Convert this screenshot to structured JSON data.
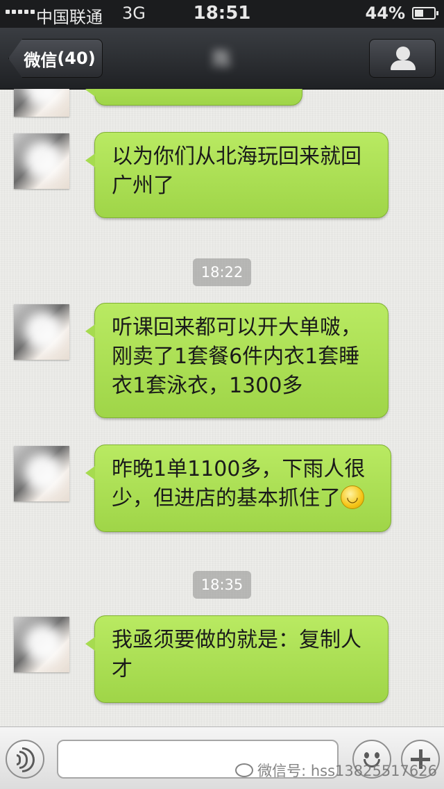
{
  "status_bar": {
    "carrier": "中国联通",
    "network": "3G",
    "time": "18:51",
    "battery": "44%"
  },
  "nav": {
    "back_label": "微信",
    "back_count": "(40)",
    "title": "陈"
  },
  "messages": [
    {
      "type": "msg",
      "text": "以为你们从北海玩回来就回广州了"
    },
    {
      "type": "time",
      "text": "18:22"
    },
    {
      "type": "msg",
      "text": "听课回来都可以开大单啵，刚卖了1套餐6件内衣1套睡衣1套泳衣，1300多"
    },
    {
      "type": "msg",
      "text": "昨晚1单1100多，下雨人很少，但进店的基本抓住了"
    },
    {
      "type": "time",
      "text": "18:35"
    },
    {
      "type": "msg",
      "text": "我亟须要做的就是：复制人才"
    }
  ],
  "watermark": "微信号: hss13825517626",
  "colors": {
    "bubble": "#a6db4f",
    "nav": "#2a2c30"
  }
}
